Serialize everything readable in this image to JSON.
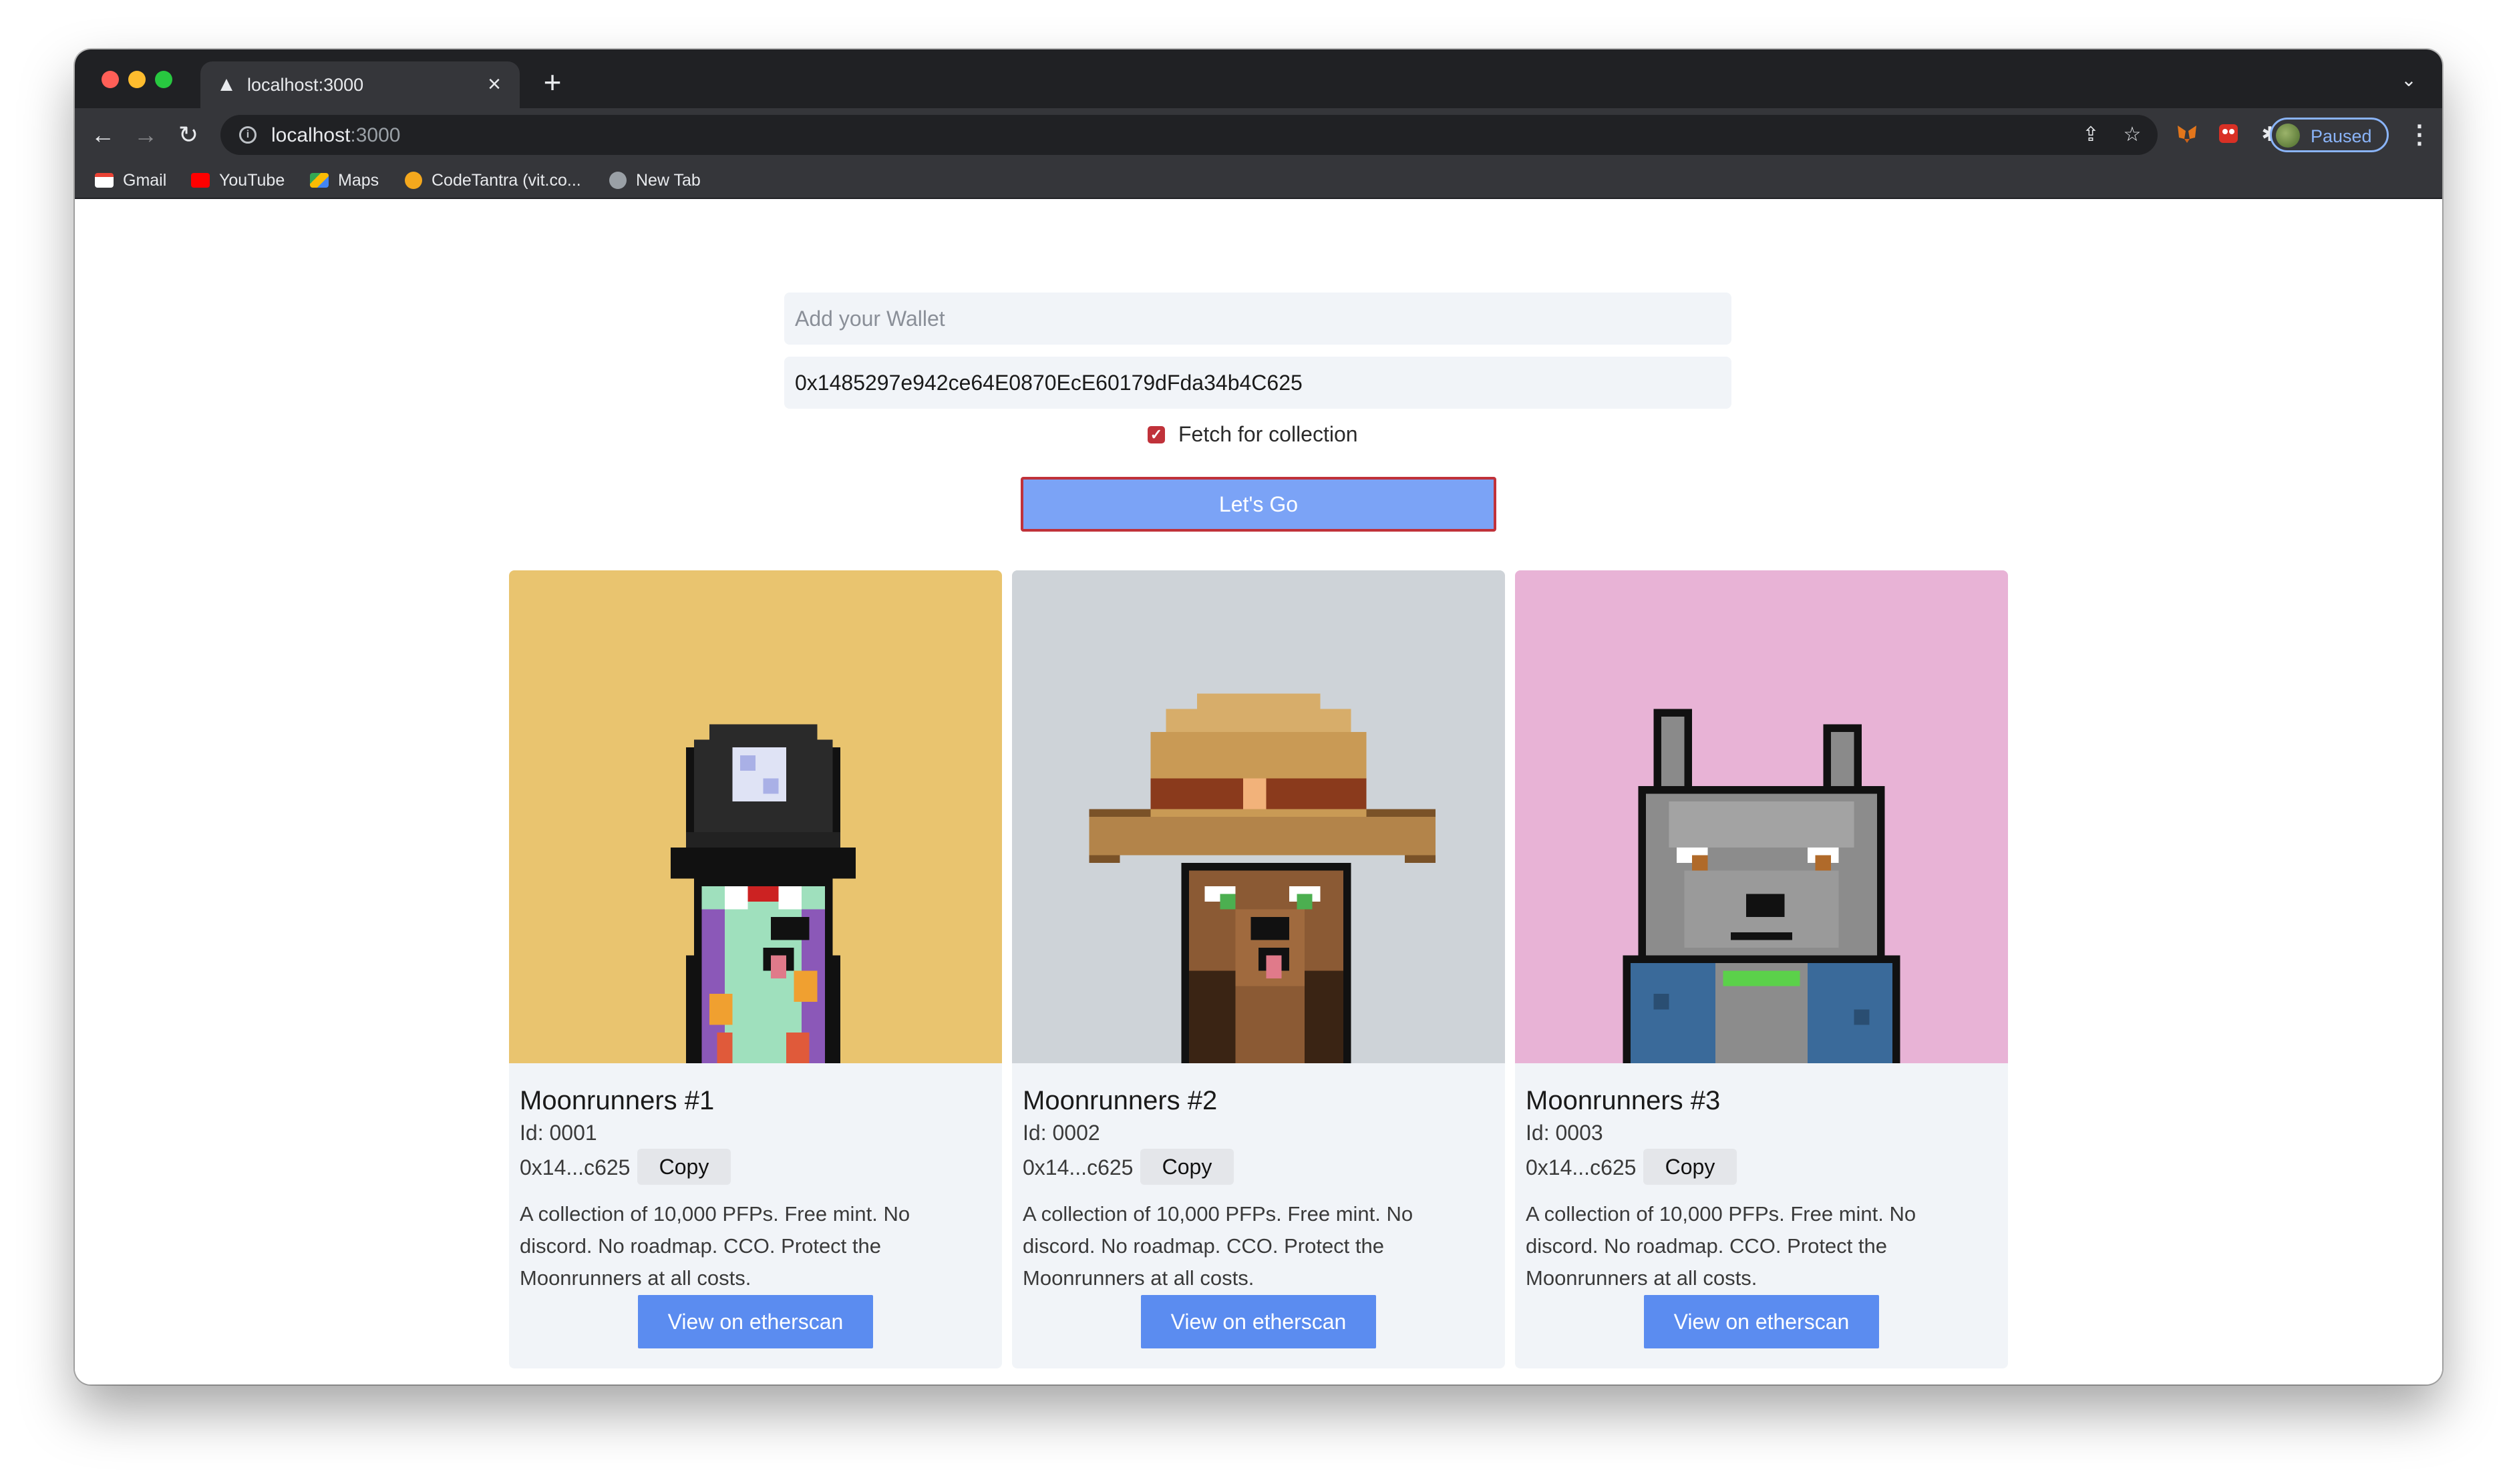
{
  "browser": {
    "tab_title": "localhost:3000",
    "url_host": "localhost",
    "url_port": ":3000",
    "profile_status": "Paused",
    "bookmarks": [
      {
        "label": "Gmail",
        "icon": "gmail-icon"
      },
      {
        "label": "YouTube",
        "icon": "youtube-icon"
      },
      {
        "label": "Maps",
        "icon": "maps-icon"
      },
      {
        "label": "CodeTantra (vit.co...",
        "icon": "codetantra-icon"
      },
      {
        "label": "New Tab",
        "icon": "globe-icon"
      }
    ]
  },
  "form": {
    "wallet_placeholder": "Add your Wallet",
    "wallet_value": "",
    "collection_value": "0x1485297e942ce64E0870EcE60179dFda34b4C625",
    "checkbox_label": "Fetch for collection",
    "checkbox_checked": true,
    "submit_label": "Let's Go"
  },
  "cards": [
    {
      "title": "Moonrunners #1",
      "id": "Id: 0001",
      "address": "0x14...c625",
      "copy_label": "Copy",
      "description": "A collection of 10,000 PFPs. Free mint. No discord. No roadmap. CCO. Protect the Moonrunners at all costs.",
      "button_label": "View on etherscan",
      "bg_color": "#e9c46f"
    },
    {
      "title": "Moonrunners #2",
      "id": "Id: 0002",
      "address": "0x14...c625",
      "copy_label": "Copy",
      "description": "A collection of 10,000 PFPs. Free mint. No discord. No roadmap. CCO. Protect the Moonrunners at all costs.",
      "button_label": "View on etherscan",
      "bg_color": "#ced3d8"
    },
    {
      "title": "Moonrunners #3",
      "id": "Id: 0003",
      "address": "0x14...c625",
      "copy_label": "Copy",
      "description": "A collection of 10,000 PFPs. Free mint. No discord. No roadmap. CCO. Protect the Moonrunners at all costs.",
      "button_label": "View on etherscan",
      "bg_color": "#e8b3d6"
    }
  ],
  "next_row_colors": [
    "#8fd38f",
    "#c9cdd2",
    "#e8b3d6"
  ]
}
